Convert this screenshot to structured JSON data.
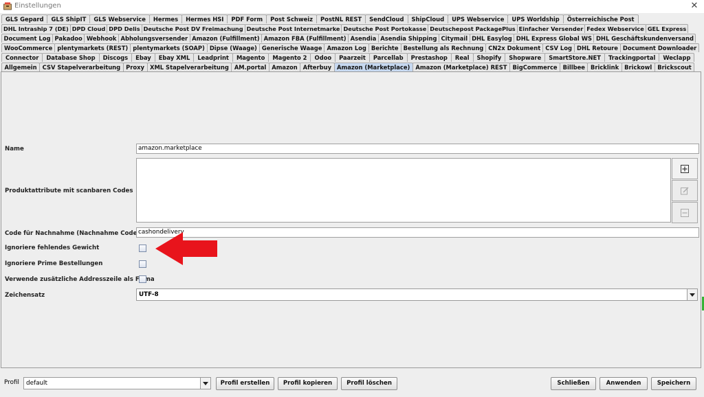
{
  "window": {
    "title": "Einstellungen",
    "close_glyph": "✕"
  },
  "tab_rows": [
    [
      "GLS Gepard",
      "GLS ShipIT",
      "GLS Webservice",
      "Hermes",
      "Hermes HSI",
      "PDF Form",
      "Post Schweiz",
      "PostNL REST",
      "SendCloud",
      "ShipCloud",
      "UPS Webservice",
      "UPS Worldship",
      "Österreichische Post"
    ],
    [
      "DHL Intraship 7 (DE)",
      "DPD Cloud",
      "DPD Delis",
      "Deutsche Post DV Freimachung",
      "Deutsche Post Internetmarke",
      "Deutsche Post Portokasse",
      "Deutschepost PackagePlus",
      "Einfacher Versender",
      "Fedex Webservice",
      "GEL Express"
    ],
    [
      "Document Log",
      "Pakadoo",
      "Webhook",
      "Abholungsversender",
      "Amazon (Fulfillment)",
      "Amazon FBA (Fulfillment)",
      "Asendia",
      "Asendia Shipping",
      "Citymail",
      "DHL Easylog",
      "DHL Express Global WS",
      "DHL Geschäftskundenversand"
    ],
    [
      "WooCommerce",
      "plentymarkets (REST)",
      "plentymarkets (SOAP)",
      "Dipse (Waage)",
      "Generische Waage",
      "Amazon Log",
      "Berichte",
      "Bestellung als Rechnung",
      "CN2x Dokument",
      "CSV Log",
      "DHL Retoure",
      "Document Downloader"
    ],
    [
      "Connector",
      "Database Shop",
      "Discogs",
      "Ebay",
      "Ebay XML",
      "Leadprint",
      "Magento",
      "Magento 2",
      "Odoo",
      "Paarzeit",
      "Parcellab",
      "Prestashop",
      "Real",
      "Shopify",
      "Shopware",
      "SmartStore.NET",
      "Trackingportal",
      "Weclapp"
    ],
    [
      "Allgemein",
      "CSV Stapelverarbeitung",
      "Proxy",
      "XML Stapelverarbeitung",
      "AM.portal",
      "Amazon",
      "Afterbuy",
      "Amazon (Marketplace)",
      "Amazon (Marketplace) REST",
      "BigCommerce",
      "Billbee",
      "Bricklink",
      "Brickowl",
      "Brickscout"
    ]
  ],
  "active_tab": "Amazon (Marketplace)",
  "form": {
    "name_label": "Name",
    "name_value": "amazon.marketplace",
    "attrs_label": "Produktattribute mit scanbaren Codes",
    "cod_label": "Code für Nachnahme (Nachnahme Code)",
    "cod_value": "cashondelivery",
    "ignore_weight_label": "Ignoriere fehlendes Gewicht",
    "ignore_prime_label": "Ignoriere Prime Bestellungen",
    "extra_address_label": "Verwende zusätzliche Addresszeile als Firma",
    "charset_label": "Zeichensatz",
    "charset_value": "UTF-8"
  },
  "checkboxes": {
    "ignore_weight": false,
    "ignore_prime": false,
    "extra_address": false
  },
  "bottom": {
    "profile_label": "Profil",
    "profile_value": "default",
    "create_profile": "Profil erstellen",
    "copy_profile": "Profil kopieren",
    "delete_profile": "Profil löschen",
    "close": "Schließen",
    "apply": "Anwenden",
    "save": "Speichern"
  },
  "icons": [
    "app-icon",
    "close-icon",
    "add-icon",
    "edit-icon",
    "remove-icon",
    "chevron-down-icon",
    "red-arrow-annotation"
  ],
  "colors": {
    "active_tab": "#c6d8f0",
    "annotation_arrow": "#e8141c",
    "window_bg": "#eeeeee"
  }
}
